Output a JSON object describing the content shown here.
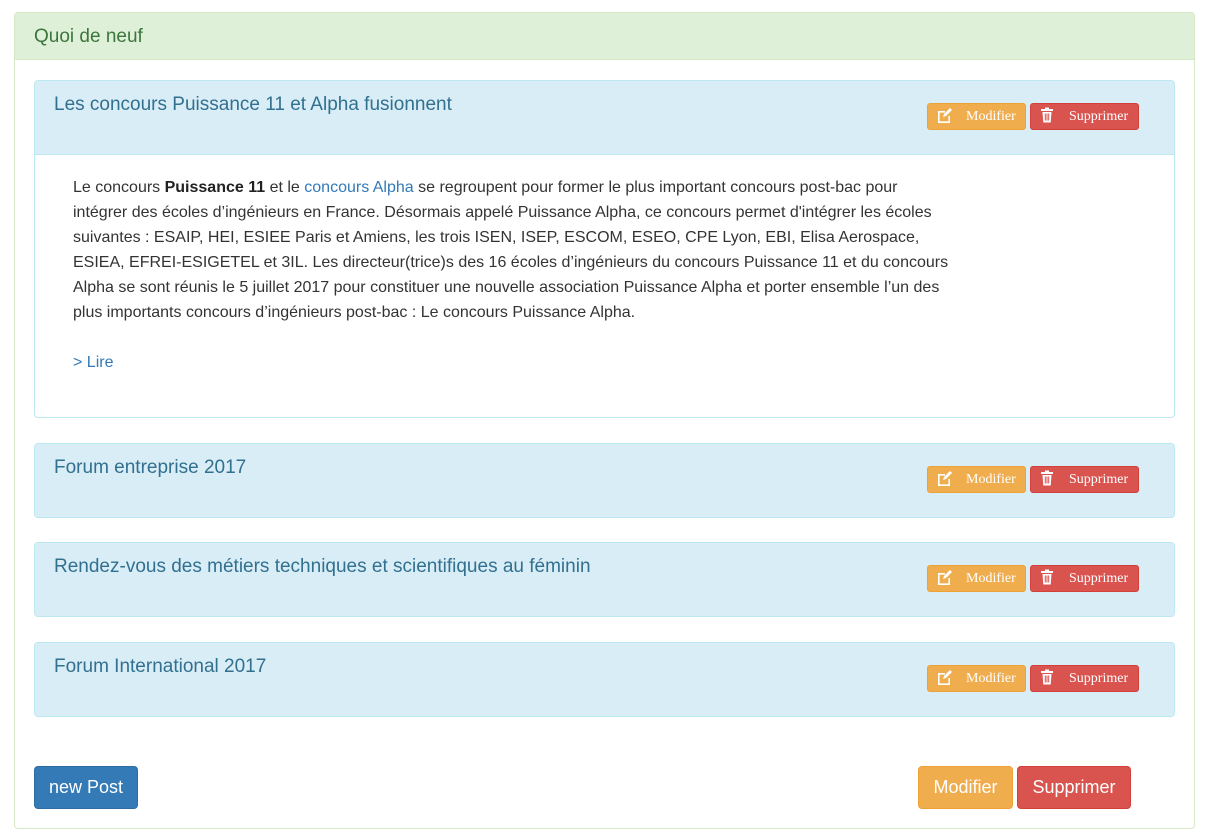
{
  "panel": {
    "title": "Quoi de neuf"
  },
  "posts": [
    {
      "title": "Les concours Puissance 11 et Alpha fusionnent",
      "modify_label": "Modifier",
      "delete_label": "Supprimer",
      "body": {
        "text_1": "Le concours ",
        "bold_1": "Puissance 11",
        "text_2": " et le ",
        "link_1": "concours Alpha",
        "text_3": " se regroupent pour former le plus important concours post-bac pour intégrer des écoles d’ingénieurs en France. Désormais appelé Puissance Alpha, ce concours permet d'intégrer les écoles suivantes : ESAIP, HEI, ESIEE Paris et Amiens, les trois ISEN, ISEP, ESCOM, ESEO, CPE Lyon, EBI, Elisa Aerospace, ESIEA, EFREI-ESIGETEL et 3IL. Les directeur(trice)s des 16 écoles d’ingénieurs du concours Puissance 11 et du concours Alpha se sont réunis le 5 juillet 2017 pour constituer une nouvelle association Puissance Alpha et porter ensemble l’un des plus importants concours d’ingénieurs post-bac : Le concours Puissance Alpha.",
        "read_more": "> Lire"
      }
    },
    {
      "title": "Forum entreprise 2017",
      "modify_label": "Modifier",
      "delete_label": "Supprimer"
    },
    {
      "title": "Rendez-vous des métiers techniques et scientifiques au féminin",
      "modify_label": "Modifier",
      "delete_label": "Supprimer"
    },
    {
      "title": "Forum International 2017",
      "modify_label": "Modifier",
      "delete_label": "Supprimer"
    }
  ],
  "footer": {
    "new_post_label": "new Post",
    "modify_label": "Modifier",
    "delete_label": "Supprimer"
  },
  "icons": {
    "edit": "edit-icon",
    "delete": "trash-icon"
  },
  "colors": {
    "success_bg": "#dff0d8",
    "success_text": "#3c763d",
    "info_bg": "#d9edf7",
    "info_text": "#31708f",
    "warning": "#f0ad4e",
    "danger": "#d9534f",
    "primary": "#337ab7"
  }
}
